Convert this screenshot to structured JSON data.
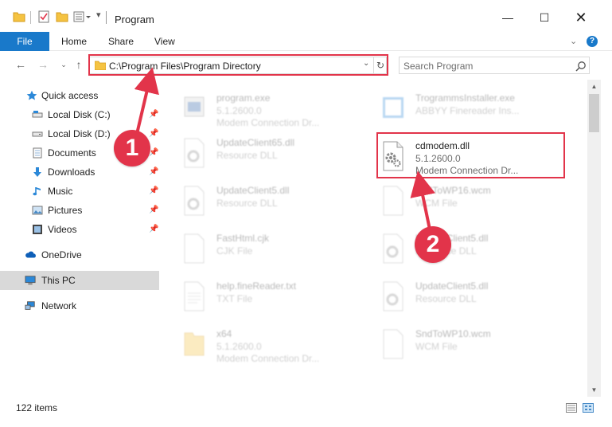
{
  "window": {
    "title": "Program"
  },
  "ribbon": {
    "file_label": "File",
    "home_label": "Home",
    "share_label": "Share",
    "view_label": "View"
  },
  "address": {
    "path": "C:\\Program Files\\Program Directory"
  },
  "search": {
    "placeholder": "Search Program"
  },
  "sidebar": {
    "quick_access": "Quick access",
    "items": [
      {
        "label": "Local Disk (C:)"
      },
      {
        "label": "Local Disk (D:)"
      },
      {
        "label": "Documents"
      },
      {
        "label": "Downloads"
      },
      {
        "label": "Music"
      },
      {
        "label": "Pictures"
      },
      {
        "label": "Videos"
      }
    ],
    "onedrive": "OneDrive",
    "this_pc": "This PC",
    "network": "Network"
  },
  "files": {
    "left": [
      {
        "name": "program.exe",
        "line2": "5.1.2600.0",
        "line3": "Modem Connection Dr..."
      },
      {
        "name": "UpdateClient65.dll",
        "line2": "Resource DLL",
        "line3": ""
      },
      {
        "name": "UpdateClient5.dll",
        "line2": "Resource DLL",
        "line3": ""
      },
      {
        "name": "FastHtml.cjk",
        "line2": "CJK File",
        "line3": ""
      },
      {
        "name": "help.fineReader.txt",
        "line2": "TXT File",
        "line3": ""
      },
      {
        "name": "x64",
        "line2": "5.1.2600.0",
        "line3": "Modem Connection Dr..."
      }
    ],
    "right": [
      {
        "name": "TrogrammsInstaller.exe",
        "line2": "ABBYY Finereader Ins...",
        "line3": ""
      },
      {
        "name": "cdmodem.dll",
        "line2": "5.1.2600.0",
        "line3": "Modem Connection Dr..."
      },
      {
        "name": "SndToWP16.wcm",
        "line2": "WCM File",
        "line3": ""
      },
      {
        "name": "UpdateClient5.dll",
        "line2": "Resource DLL",
        "line3": ""
      },
      {
        "name": "UpdateClient5.dll",
        "line2": "Resource DLL",
        "line3": ""
      },
      {
        "name": "SndToWP10.wcm",
        "line2": "WCM File",
        "line3": ""
      }
    ]
  },
  "status": {
    "items_count": "122 items"
  },
  "callouts": {
    "one": "1",
    "two": "2"
  },
  "colors": {
    "accent": "#1979ca",
    "highlight_red": "#e2344a",
    "selected_nav": "#d9d9d9"
  },
  "icons": [
    "folder-icon",
    "properties-icon",
    "back-icon",
    "forward-icon",
    "up-icon",
    "refresh-icon",
    "search-icon",
    "star-icon",
    "drive-icon",
    "documents-icon",
    "downloads-icon",
    "music-icon",
    "pictures-icon",
    "videos-icon",
    "onedrive-icon",
    "computer-icon",
    "network-icon",
    "dll-gear-icon"
  ]
}
